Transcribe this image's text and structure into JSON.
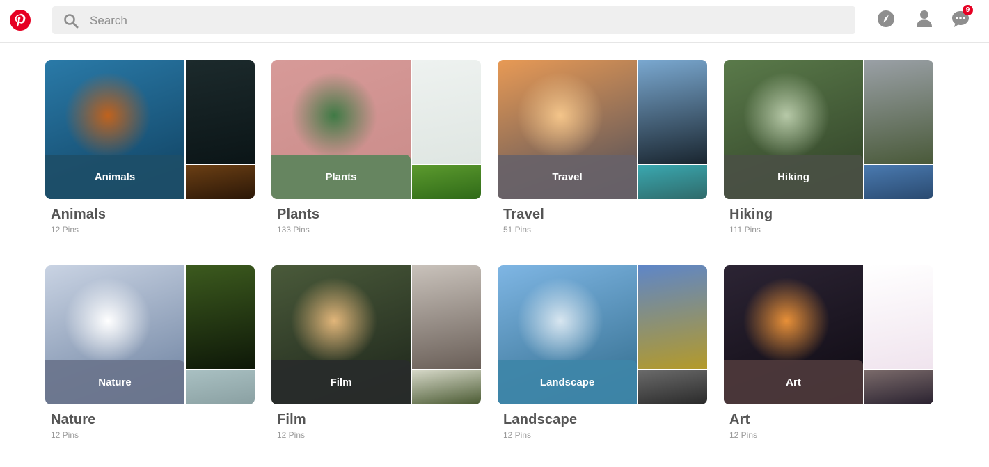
{
  "header": {
    "logo": {
      "icon": "pinterest-logo-icon",
      "color": "#e60023"
    },
    "search": {
      "placeholder": "Search",
      "value": "",
      "icon": "search-icon"
    },
    "actions": [
      {
        "name": "explore",
        "icon": "compass-icon"
      },
      {
        "name": "profile",
        "icon": "user-icon"
      },
      {
        "name": "messages",
        "icon": "chat-icon",
        "badge": "9"
      }
    ]
  },
  "boards": [
    {
      "title": "Animals",
      "count": "12 Pins",
      "overlay_label": "Animals",
      "colors": {
        "main": [
          "#2a7aa8",
          "#0f3f5e"
        ],
        "accent": "#c0621d",
        "top": [
          "#1c2a2c",
          "#0b1517"
        ],
        "bot": [
          "#6b3f14",
          "#2b1707"
        ],
        "overlay": "rgba(29,78,104,0.92)"
      }
    },
    {
      "title": "Plants",
      "count": "133 Pins",
      "overlay_label": "Plants",
      "colors": {
        "main": [
          "#d79a98",
          "#c98b89"
        ],
        "accent": "#3f7a45",
        "top": [
          "#eef2f0",
          "#dfe6e2"
        ],
        "bot": [
          "#5c9a2e",
          "#2f6a18"
        ],
        "overlay": "rgba(93,132,92,0.92)"
      }
    },
    {
      "title": "Travel",
      "count": "51 Pins",
      "overlay_label": "Travel",
      "colors": {
        "main": [
          "#e89a55",
          "#4a4c5a"
        ],
        "accent": "#f4c58a",
        "top": [
          "#7aa8d0",
          "#1a2630"
        ],
        "bot": [
          "#3aa8b0",
          "#2f6a6a"
        ],
        "overlay": "rgba(104,98,104,0.92)"
      }
    },
    {
      "title": "Hiking",
      "count": "111 Pins",
      "overlay_label": "Hiking",
      "colors": {
        "main": [
          "#5a7a4a",
          "#2f3f26"
        ],
        "accent": "#b7c9a8",
        "top": [
          "#9aa0a6",
          "#4a5a3a"
        ],
        "bot": [
          "#4a7ab0",
          "#2a4a70"
        ],
        "overlay": "rgba(74,80,68,0.92)"
      }
    },
    {
      "title": "Nature",
      "count": "12 Pins",
      "overlay_label": "Nature",
      "colors": {
        "main": [
          "#c9d3e3",
          "#6a7f9e"
        ],
        "accent": "#ffffff",
        "top": [
          "#3c5a1e",
          "#0e1808"
        ],
        "bot": [
          "#a9c0c2",
          "#8aa0a2"
        ],
        "overlay": "rgba(106,116,140,0.92)"
      }
    },
    {
      "title": "Film",
      "count": "12 Pins",
      "overlay_label": "Film",
      "colors": {
        "main": [
          "#4a5a3a",
          "#1c241a"
        ],
        "accent": "#e2b67a",
        "top": [
          "#c9c2bb",
          "#6a5f58"
        ],
        "bot": [
          "#d6d8c8",
          "#4a5a32"
        ],
        "overlay": "rgba(40,44,42,0.94)"
      }
    },
    {
      "title": "Landscape",
      "count": "12 Pins",
      "overlay_label": "Landscape",
      "colors": {
        "main": [
          "#7fb6e4",
          "#2f6a8a"
        ],
        "accent": "#d8e6f0",
        "top": [
          "#5e86c8",
          "#b49a2a"
        ],
        "bot": [
          "#6a6a6a",
          "#2a2a2a"
        ],
        "overlay": "rgba(62,134,168,0.92)"
      }
    },
    {
      "title": "Art",
      "count": "12 Pins",
      "overlay_label": "Art",
      "colors": {
        "main": [
          "#2c2434",
          "#0e0a12"
        ],
        "accent": "#e89038",
        "top": [
          "#ffffff",
          "#f0e4ee"
        ],
        "bot": [
          "#7a6a6a",
          "#2a2230"
        ],
        "overlay": "rgba(78,58,60,0.92)"
      }
    }
  ]
}
